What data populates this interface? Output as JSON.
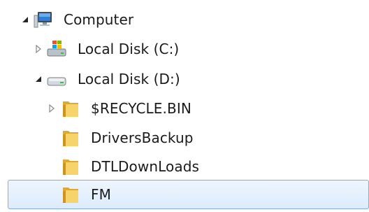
{
  "tree": {
    "computer": {
      "label": "Computer",
      "icon": "computer-icon",
      "expanded": true
    },
    "local_disk_c": {
      "label": "Local Disk (C:)",
      "icon": "windows-drive-icon",
      "expanded": false
    },
    "local_disk_d": {
      "label": "Local Disk (D:)",
      "icon": "drive-icon",
      "expanded": true
    },
    "folders": [
      {
        "label": "$RECYCLE.BIN",
        "icon": "folder-icon",
        "has_children": true,
        "selected": false
      },
      {
        "label": "DriversBackup",
        "icon": "folder-icon",
        "has_children": false,
        "selected": false
      },
      {
        "label": "DTLDownLoads",
        "icon": "folder-icon",
        "has_children": false,
        "selected": false
      },
      {
        "label": "FM",
        "icon": "folder-icon",
        "has_children": false,
        "selected": true
      }
    ]
  },
  "colors": {
    "selection_border": "#84acdd",
    "selection_fill": "#dcebfc",
    "folder": "#f2c14e",
    "text": "#1a1a1a"
  }
}
